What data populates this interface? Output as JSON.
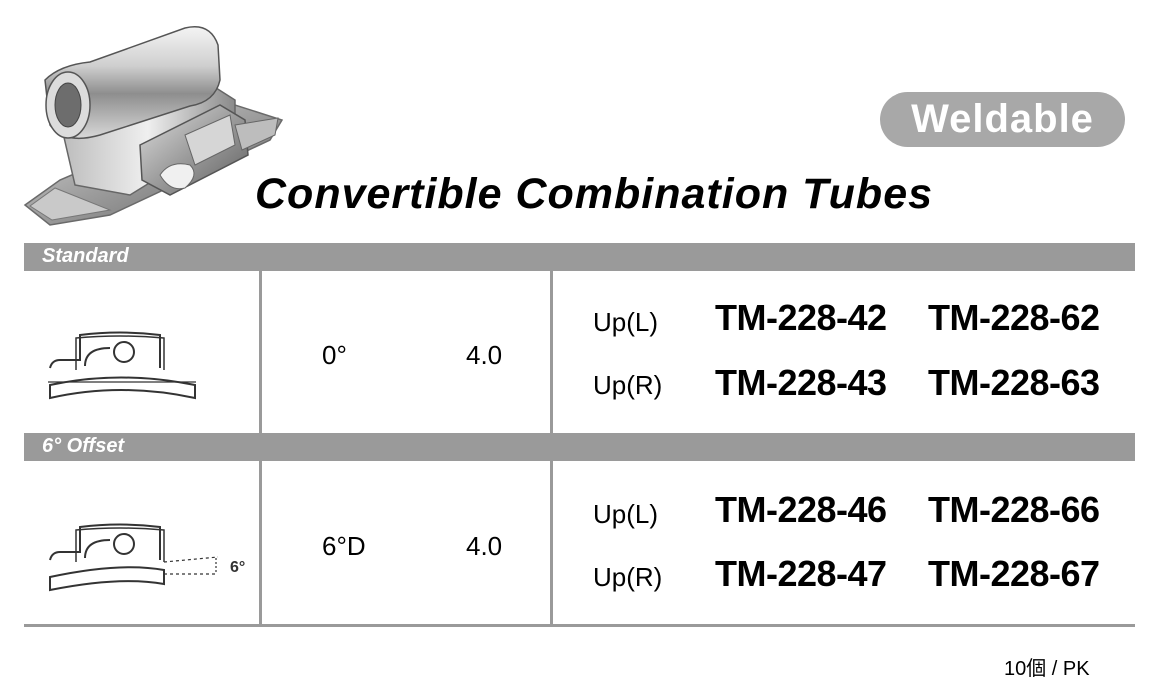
{
  "header": {
    "badge": "Weldable",
    "title": "Convertible Combination Tubes"
  },
  "sections": [
    {
      "label": "Standard",
      "torque": "0°",
      "value": "4.0",
      "rows": [
        {
          "side": "Up(L)",
          "code_a": "TM-228-42",
          "code_b": "TM-228-62"
        },
        {
          "side": "Up(R)",
          "code_a": "TM-228-43",
          "code_b": "TM-228-63"
        }
      ]
    },
    {
      "label": "6° Offset",
      "torque": "6°D",
      "value": "4.0",
      "offset_marker": "6°",
      "rows": [
        {
          "side": "Up(L)",
          "code_a": "TM-228-46",
          "code_b": "TM-228-66"
        },
        {
          "side": "Up(R)",
          "code_a": "TM-228-47",
          "code_b": "TM-228-67"
        }
      ]
    }
  ],
  "footer": {
    "pack": "10個 / PK"
  },
  "colors": {
    "bar_gray": "#9a9a9a",
    "badge_gray": "#a8a8a8",
    "text": "#000000"
  }
}
